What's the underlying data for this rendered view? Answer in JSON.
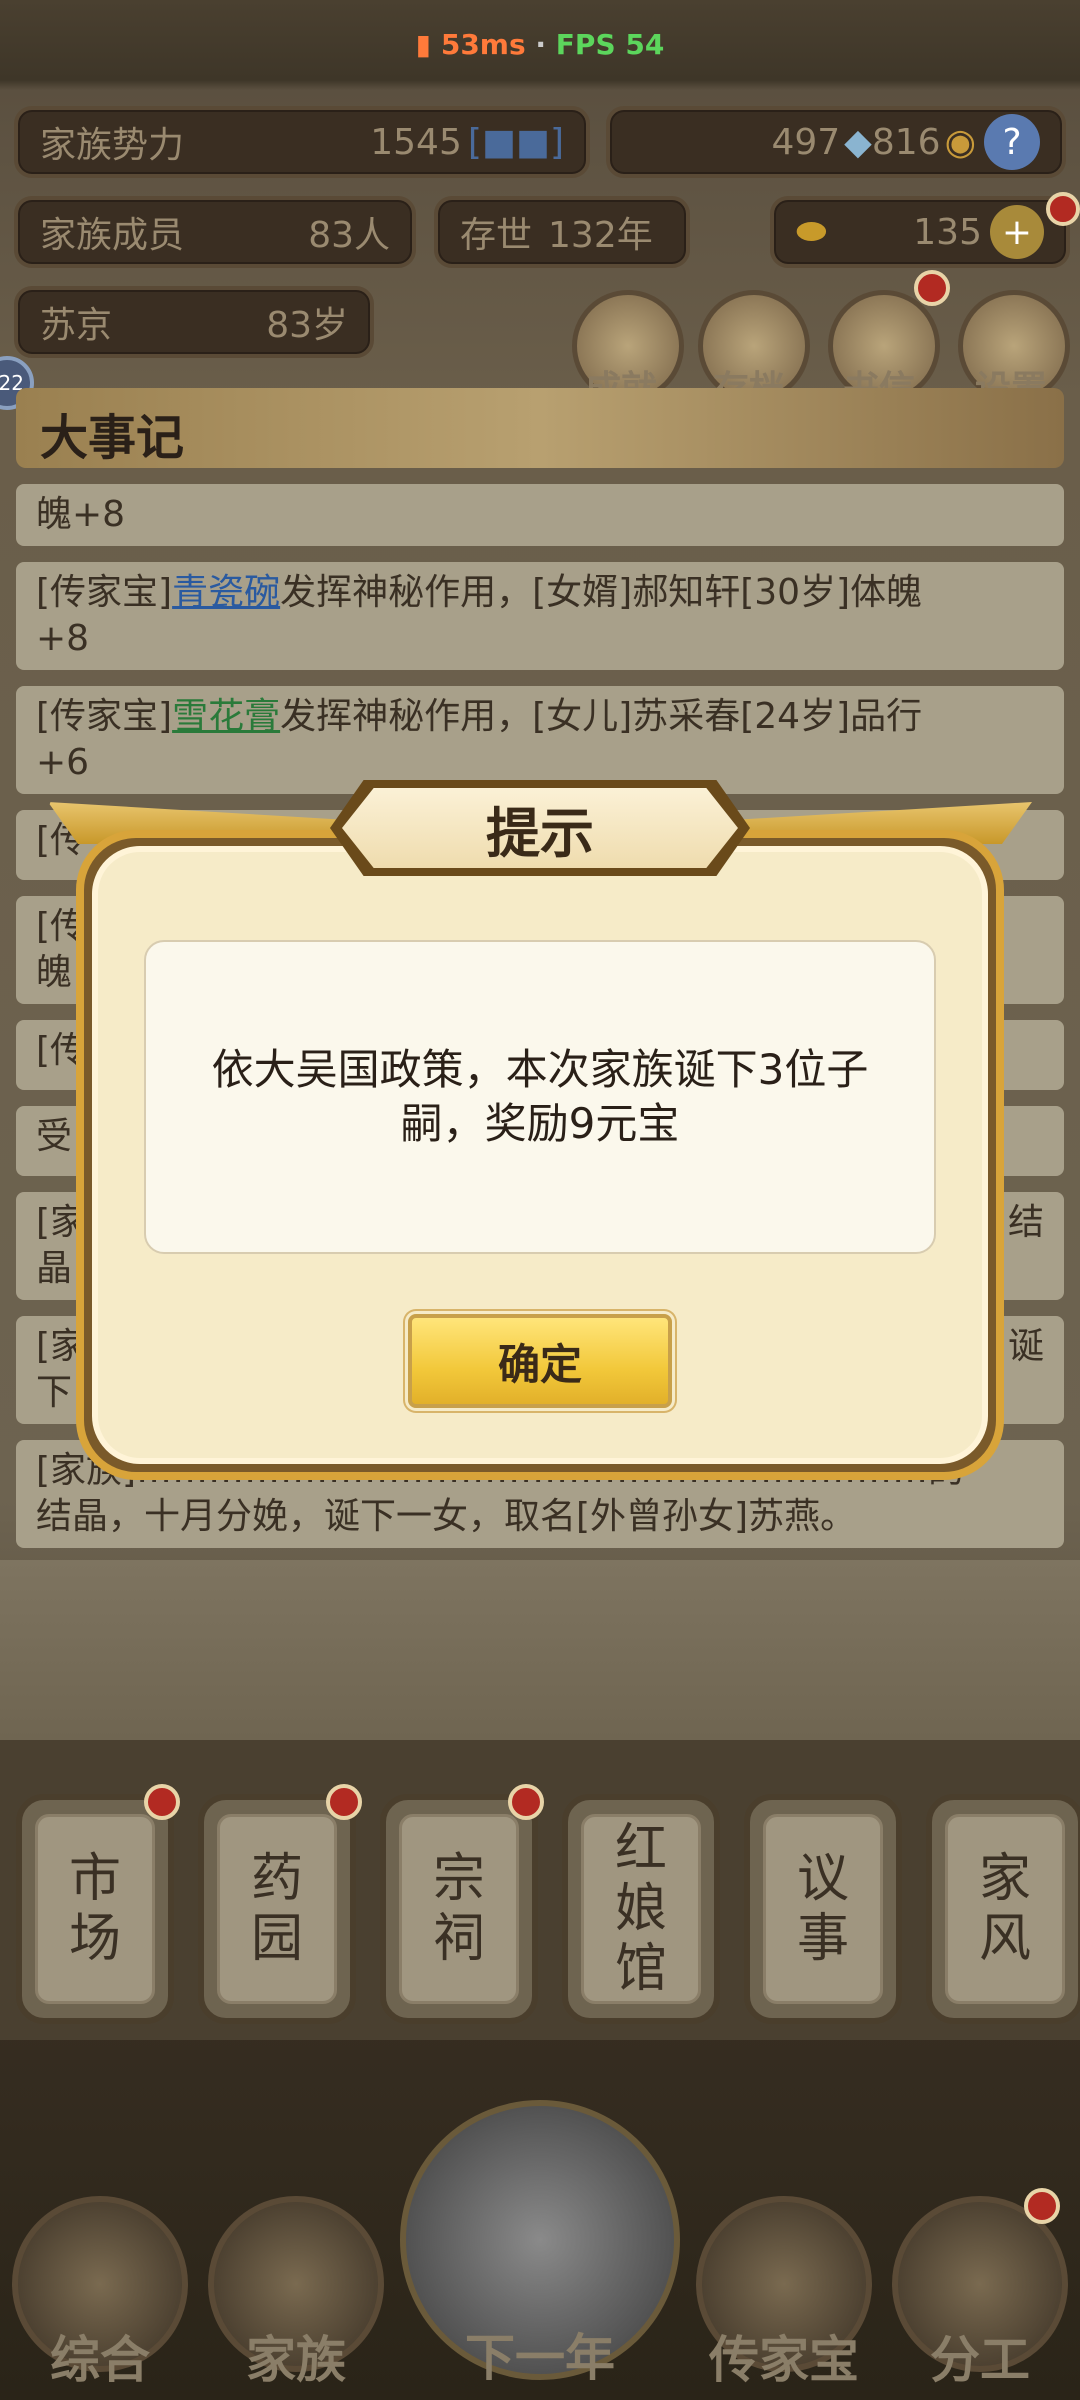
{
  "status_bar": {
    "ping": "53ms",
    "separator": "·",
    "fps": "FPS 54"
  },
  "stats": {
    "power_label": "家族势力",
    "power_value": "1545",
    "power_rank": "[■■]",
    "silver": "497",
    "coins": "816",
    "members_label": "家族成员",
    "members_value": "83人",
    "years_label": "存世",
    "years_value": "132年",
    "gold": "135",
    "leader_name": "苏京",
    "leader_age": "83岁"
  },
  "side_badge": "22",
  "top_buttons": [
    {
      "label": "成就"
    },
    {
      "label": "存档"
    },
    {
      "label": "书信"
    },
    {
      "label": "设置"
    }
  ],
  "log": {
    "title": "大事记",
    "rows": [
      {
        "text": "魄+8"
      },
      {
        "pre": "[传家宝]",
        "link": "青瓷碗",
        "post": "发挥神秘作用，[女婿]郝知轩[30岁]体魄",
        "line2": "+8",
        "link_color": "blue"
      },
      {
        "pre": "[传家宝]",
        "link": "雪花膏",
        "post": "发挥神秘作用，[女儿]苏采春[24岁]品行",
        "line2": "+6",
        "link_color": "green"
      },
      {
        "text": "[家族]…………………………………………………………的",
        "line2": "结晶，十月分娩，诞下一女，取名[外曾孙女]苏燕。"
      }
    ],
    "partial_left": [
      "[传",
      "[传",
      "魄",
      "[传",
      "受",
      "[家",
      "晶",
      "[家",
      "下"
    ],
    "partial_right": [
      "结",
      "诞"
    ]
  },
  "dialog": {
    "title": "提示",
    "message": "依大吴国政策，本次家族诞下3位子嗣，奖励9元宝",
    "confirm": "确定"
  },
  "tabs": [
    {
      "chars": [
        "市",
        "场"
      ],
      "dot": true
    },
    {
      "chars": [
        "药",
        "园"
      ],
      "dot": true
    },
    {
      "chars": [
        "宗",
        "祠"
      ],
      "dot": true
    },
    {
      "chars": [
        "红",
        "娘",
        "馆"
      ],
      "dot": false
    },
    {
      "chars": [
        "议",
        "事"
      ],
      "dot": false
    },
    {
      "chars": [
        "家",
        "风"
      ],
      "dot": false
    }
  ],
  "bottom_nav": [
    {
      "label": "综合"
    },
    {
      "label": "家族"
    },
    {
      "label": "下一年"
    },
    {
      "label": "传家宝"
    },
    {
      "label": "分工"
    }
  ]
}
